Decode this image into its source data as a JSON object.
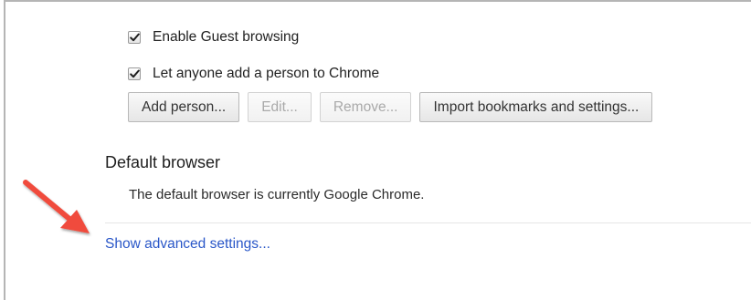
{
  "users": {
    "guest_label": "Enable Guest browsing",
    "guest_checked": true,
    "anyone_label": "Let anyone add a person to Chrome",
    "anyone_checked": true,
    "buttons": {
      "add": "Add person...",
      "edit": "Edit...",
      "remove": "Remove...",
      "import": "Import bookmarks and settings..."
    }
  },
  "default_browser": {
    "title": "Default browser",
    "status": "The default browser is currently Google Chrome."
  },
  "advanced": {
    "link_label": "Show advanced settings..."
  },
  "annotation": {
    "arrow_color": "#f04b3c"
  },
  "colors": {
    "link": "#2a57c8",
    "disabled_text": "#a9a9a9"
  },
  "icons": {
    "check": "check-icon",
    "arrow": "red-arrow-icon"
  }
}
